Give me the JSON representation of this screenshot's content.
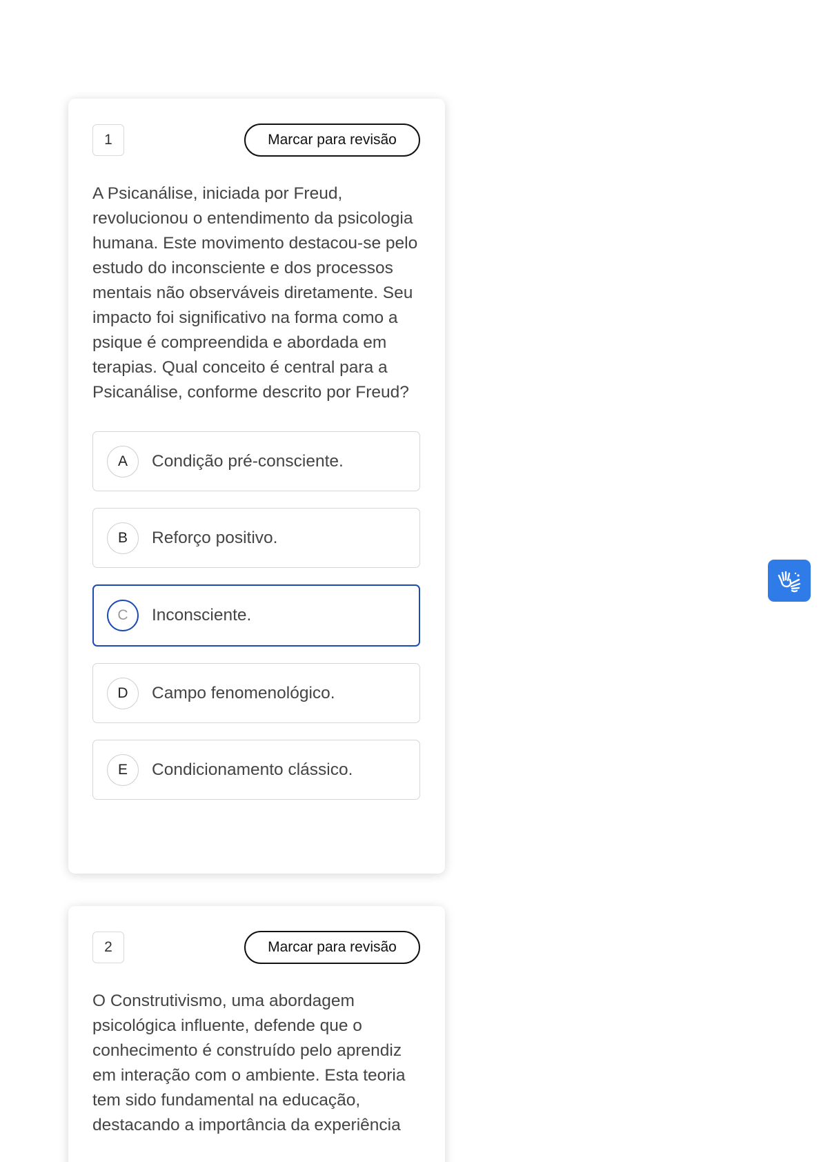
{
  "questions": [
    {
      "number": "1",
      "review_label": "Marcar para revisão",
      "stem": "A Psicanálise, iniciada por Freud, revolucionou o entendimento da psicologia humana. Este movimento destacou-se pelo estudo do inconsciente e dos processos mentais não observáveis diretamente. Seu impacto foi significativo na forma como a psique é compreendida e abordada em terapias. Qual conceito é central para a Psicanálise, conforme descrito por Freud?",
      "selected": "C",
      "options": [
        {
          "letter": "A",
          "text": "Condição pré-consciente."
        },
        {
          "letter": "B",
          "text": "Reforço positivo."
        },
        {
          "letter": "C",
          "text": "Inconsciente."
        },
        {
          "letter": "D",
          "text": "Campo fenomenológico."
        },
        {
          "letter": "E",
          "text": "Condicionamento clássico."
        }
      ]
    },
    {
      "number": "2",
      "review_label": "Marcar para revisão",
      "stem": "O Construtivismo, uma abordagem psicológica influente, defende que o conhecimento é construído pelo aprendiz em interação com o ambiente. Esta teoria tem sido fundamental na educação, destacando a importância da experiência"
    }
  ],
  "accessibility": {
    "icon": "sign-language-hands-icon",
    "color": "#2f7be8"
  },
  "colors": {
    "selected_accent": "#1c4bb4"
  }
}
